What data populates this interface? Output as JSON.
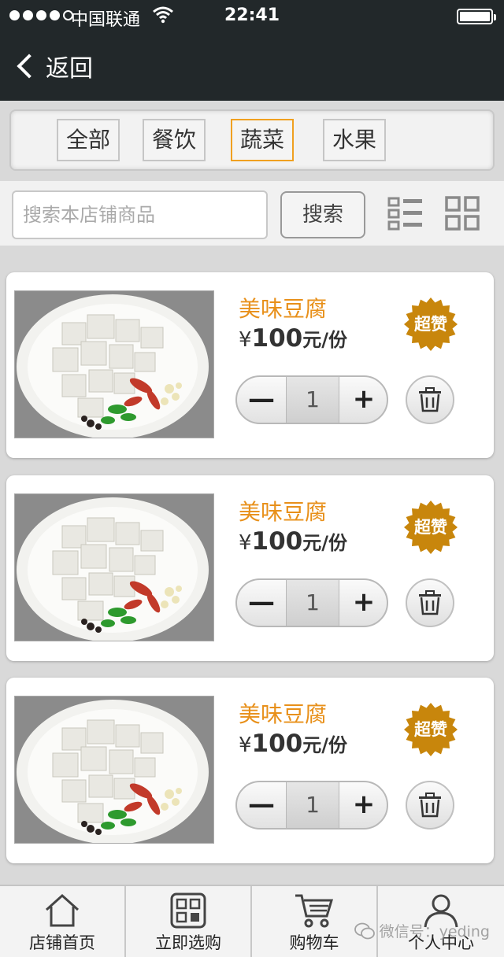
{
  "status_bar": {
    "carrier": "中国联通",
    "time": "22:41",
    "signal_dots": 5,
    "signal_filled": 4
  },
  "nav": {
    "back_label": "返回"
  },
  "categories": [
    {
      "label": "全部",
      "active": false
    },
    {
      "label": "餐饮",
      "active": false
    },
    {
      "label": "蔬菜",
      "active": true
    },
    {
      "label": "水果",
      "active": false
    }
  ],
  "search": {
    "placeholder": "搜索本店铺商品",
    "value": "",
    "button_label": "搜索"
  },
  "view_toggle": {
    "list_icon": "list-view-icon",
    "grid_icon": "grid-view-icon"
  },
  "products": [
    {
      "name": "美味豆腐",
      "currency": "¥",
      "price": "100",
      "unit": "元/份",
      "badge": "超赞",
      "quantity": "1",
      "minus": "—",
      "plus": "+"
    },
    {
      "name": "美味豆腐",
      "currency": "¥",
      "price": "100",
      "unit": "元/份",
      "badge": "超赞",
      "quantity": "1",
      "minus": "—",
      "plus": "+"
    },
    {
      "name": "美味豆腐",
      "currency": "¥",
      "price": "100",
      "unit": "元/份",
      "badge": "超赞",
      "quantity": "1",
      "minus": "—",
      "plus": "+"
    }
  ],
  "tabbar": [
    {
      "label": "店铺首页",
      "icon": "home-icon"
    },
    {
      "label": "立即选购",
      "icon": "shop-icon"
    },
    {
      "label": "购物车",
      "icon": "cart-icon"
    },
    {
      "label": "个人中心",
      "icon": "user-icon"
    }
  ],
  "watermark": "微信号：yeding",
  "colors": {
    "header_bg": "#22282a",
    "accent_orange": "#e8901a",
    "badge_gold": "#c8860c",
    "active_border": "#f0a020"
  }
}
